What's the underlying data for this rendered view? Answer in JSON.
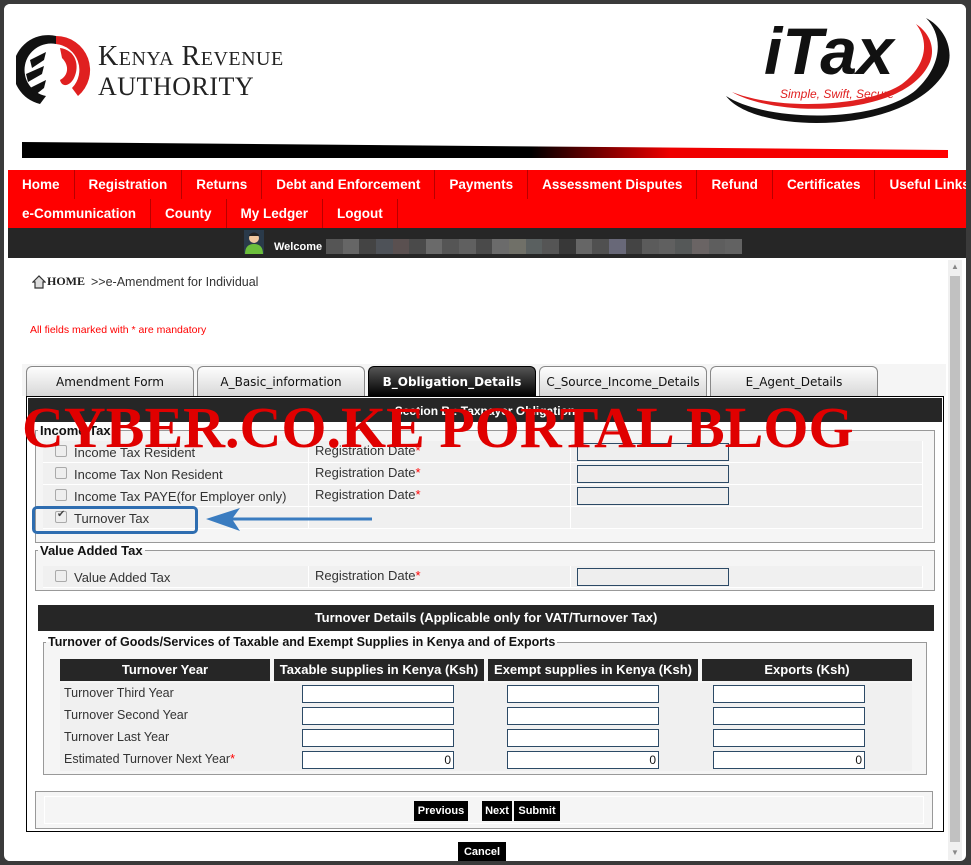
{
  "header": {
    "org_name_line1": "Kenya Revenue",
    "org_name_line2": "Authority",
    "brand": "iTax",
    "tagline": "Simple, Swift, Secure"
  },
  "nav": {
    "row1": [
      "Home",
      "Registration",
      "Returns",
      "Debt and Enforcement",
      "Payments",
      "Assessment Disputes",
      "Refund",
      "Certificates",
      "Useful Links"
    ],
    "row2": [
      "e-Communication",
      "County",
      "My Ledger",
      "Logout"
    ]
  },
  "welcome": {
    "label": "Welcome"
  },
  "breadcrumb": {
    "home": "HOME",
    "current": ">>e-Amendment for Individual"
  },
  "mandatory_note": "All fields marked with * are mandatory",
  "tabs": [
    {
      "label": "Amendment Form",
      "active": false
    },
    {
      "label": "A_Basic_information",
      "active": false
    },
    {
      "label": "B_Obligation_Details",
      "active": true
    },
    {
      "label": "C_Source_Income_Details",
      "active": false
    },
    {
      "label": "E_Agent_Details",
      "active": false
    }
  ],
  "section_title": "Section B : Taxpayer Obligation",
  "income_tax": {
    "legend": "Income Tax",
    "items": [
      {
        "label": "Income Tax Resident",
        "checked": false,
        "date_label": "Registration Date",
        "required": "*"
      },
      {
        "label": "Income Tax Non Resident",
        "checked": false,
        "date_label": "Registration Date",
        "required": "*"
      },
      {
        "label": "Income Tax PAYE(for Employer only)",
        "checked": false,
        "date_label": "Registration Date",
        "required": "*"
      },
      {
        "label": "Turnover Tax",
        "checked": true
      }
    ]
  },
  "vat": {
    "legend": "Value Added Tax",
    "item": {
      "label": "Value Added Tax",
      "checked": false,
      "date_label": "Registration Date",
      "required": "*"
    }
  },
  "turnover": {
    "header": "Turnover Details (Applicable only for VAT/Turnover Tax)",
    "legend": "Turnover of Goods/Services of Taxable and Exempt Supplies in Kenya and of Exports",
    "columns": [
      "Turnover Year",
      "Taxable supplies in Kenya (Ksh)",
      "Exempt supplies in Kenya (Ksh)",
      "Exports (Ksh)"
    ],
    "rows": [
      {
        "label": "Turnover Third Year",
        "required": "",
        "values": [
          "",
          "",
          ""
        ]
      },
      {
        "label": "Turnover Second Year",
        "required": "",
        "values": [
          "",
          "",
          ""
        ]
      },
      {
        "label": "Turnover Last Year",
        "required": "",
        "values": [
          "",
          "",
          ""
        ]
      },
      {
        "label": "Estimated Turnover Next Year",
        "required": "*",
        "values": [
          "0",
          "0",
          "0"
        ]
      }
    ]
  },
  "buttons": {
    "previous": "Previous",
    "next": "Next",
    "submit": "Submit",
    "cancel": "Cancel"
  },
  "watermark": "CYBER.CO.KE PORTAL BLOG",
  "colors": {
    "nav_red": "#ff0000",
    "dark_bar": "#262626",
    "highlight_blue": "#2e6db0",
    "watermark_red": "#e00000"
  }
}
